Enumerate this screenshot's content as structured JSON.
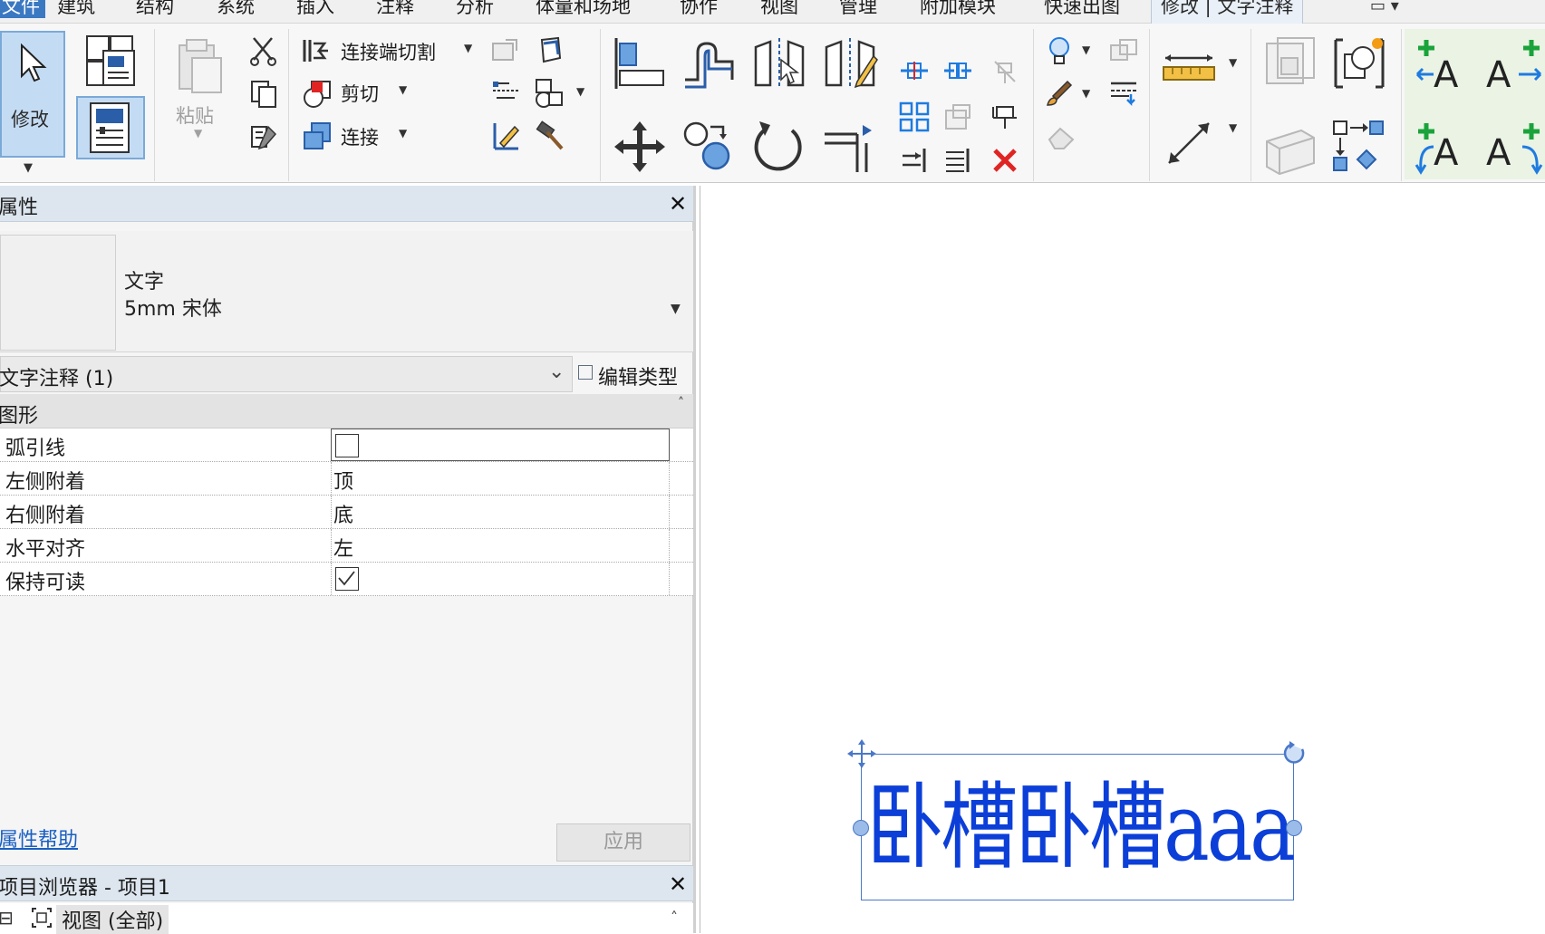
{
  "menu": {
    "tabs": [
      "文件",
      "建筑",
      "结构",
      "系统",
      "插入",
      "注释",
      "分析",
      "体量和场地",
      "协作",
      "视图",
      "管理",
      "附加模块",
      "快速出图",
      "修改 | 文字注释"
    ],
    "more": "▭ ▾"
  },
  "ribbon": {
    "modify_label": "修改",
    "paste_label": "粘贴",
    "cope_label": "连接端切割",
    "cut_label": "剪切",
    "join_label": "连接"
  },
  "properties": {
    "title": "属性",
    "type_family": "文字",
    "type_name": "5mm 宋体",
    "instance_label": "文字注释 (1)",
    "edit_type": "编辑类型",
    "group": "图形",
    "params": [
      {
        "name": "弧引线",
        "kind": "checkbox",
        "checked": false
      },
      {
        "name": "左侧附着",
        "kind": "text",
        "value": "顶"
      },
      {
        "name": "右侧附着",
        "kind": "text",
        "value": "底"
      },
      {
        "name": "水平对齐",
        "kind": "text",
        "value": "左"
      },
      {
        "name": "保持可读",
        "kind": "checkbox",
        "checked": true
      }
    ],
    "help_link": "属性帮助",
    "apply_label": "应用"
  },
  "browser": {
    "title": "项目浏览器 - 项目1",
    "tree_toggle": "⊟",
    "tree_item": "视图 (全部)"
  },
  "canvas": {
    "text": "卧槽卧槽aaa",
    "text_color": "#0c3fd8",
    "selection_color": "#4a78c9"
  },
  "colors": {
    "accent": "#3b78c2",
    "link": "#1a5fc2",
    "ribbon_blue": "#1e7be0",
    "ribbon_green": "#1aa33a",
    "ribbon_red": "#e02424"
  }
}
